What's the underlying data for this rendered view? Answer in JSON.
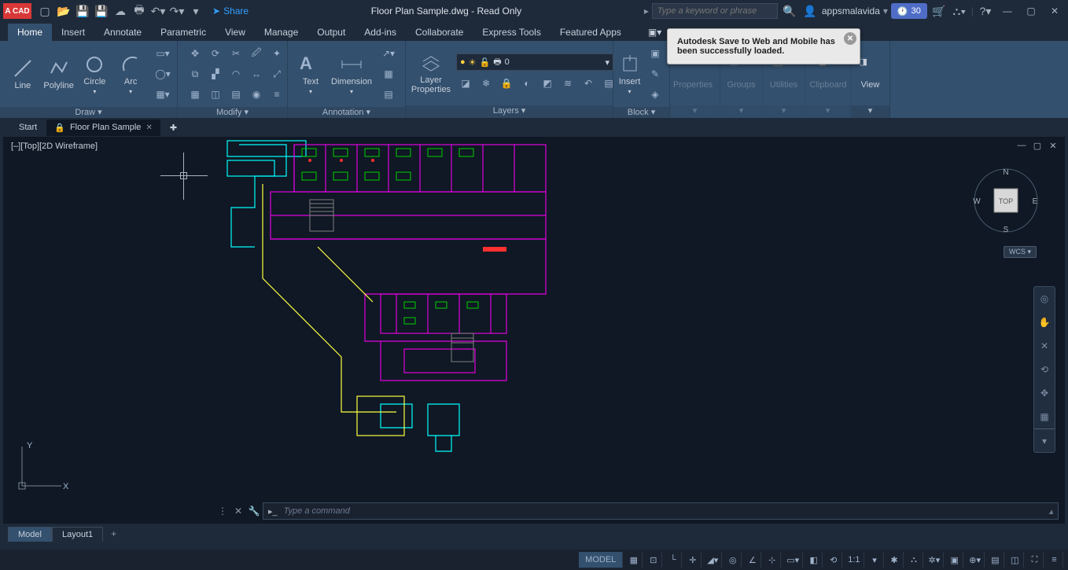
{
  "app_logo": "A CAD",
  "share_label": "Share",
  "title": "Floor Plan Sample.dwg - Read Only",
  "search_placeholder": "Type a keyword or phrase",
  "username": "appsmalavida",
  "trial_days": "30",
  "ribbon_tabs": [
    "Home",
    "Insert",
    "Annotate",
    "Parametric",
    "View",
    "Manage",
    "Output",
    "Add-ins",
    "Collaborate",
    "Express Tools",
    "Featured Apps"
  ],
  "panels": {
    "draw": {
      "label": "Draw ▾",
      "line": "Line",
      "polyline": "Polyline",
      "circle": "Circle",
      "arc": "Arc"
    },
    "modify": {
      "label": "Modify ▾"
    },
    "annotation": {
      "label": "Annotation ▾",
      "text": "Text",
      "dimension": "Dimension"
    },
    "layers": {
      "label": "Layers ▾",
      "props": "Layer\nProperties",
      "current": "0"
    },
    "block": {
      "label": "Block ▾",
      "insert": "Insert"
    },
    "properties": {
      "label": "Properties"
    },
    "groups": {
      "label": "Groups"
    },
    "utilities": {
      "label": "Utilities"
    },
    "clipboard": {
      "label": "Clipboard"
    },
    "view": {
      "label": "View"
    }
  },
  "toast_text": "Autodesk Save to Web and Mobile has been successfully loaded.",
  "file_tabs": {
    "start": "Start",
    "current": "Floor Plan Sample"
  },
  "view_label": "[–][Top][2D Wireframe]",
  "viewcube": {
    "top": "TOP",
    "n": "N",
    "s": "S",
    "e": "E",
    "w": "W",
    "wcs": "WCS ▾"
  },
  "ucs": {
    "x": "X",
    "y": "Y"
  },
  "command_placeholder": "Type a command",
  "layout_tabs": {
    "model": "Model",
    "layout1": "Layout1"
  },
  "status": {
    "model": "MODEL",
    "scale": "1:1"
  }
}
